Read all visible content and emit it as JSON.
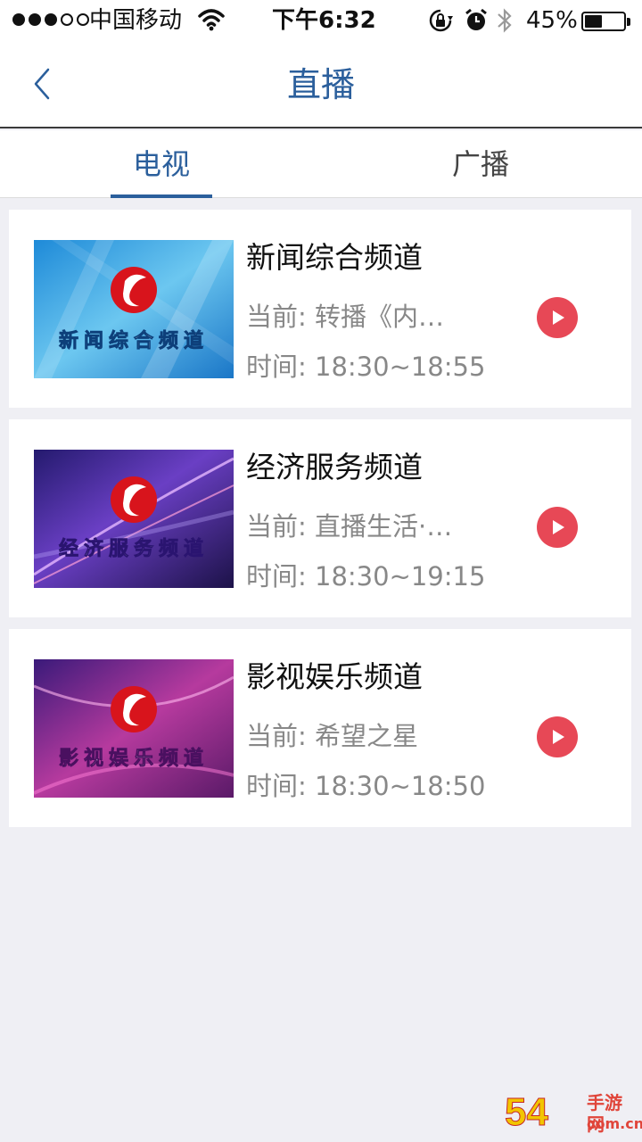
{
  "status_bar": {
    "carrier": "中国移动",
    "time": "下午6:32",
    "battery_text": "45%",
    "battery_level": 0.45
  },
  "nav": {
    "title": "直播"
  },
  "tabs": [
    {
      "label": "电视",
      "active": true
    },
    {
      "label": "广播",
      "active": false
    }
  ],
  "channels": [
    {
      "name": "新闻综合频道",
      "current": "当前: 转播《内…",
      "time": "时间: 18:30~18:55",
      "thumb_text": "新闻综合频道"
    },
    {
      "name": "经济服务频道",
      "current": "当前: 直播生活·…",
      "time": "时间: 18:30~19:15",
      "thumb_text": "经济服务频道"
    },
    {
      "name": "影视娱乐频道",
      "current": "当前: 希望之星",
      "time": "时间: 18:30~18:50",
      "thumb_text": "影视娱乐频道"
    }
  ],
  "watermark": {
    "number": "54",
    "label": "手游网",
    "url": "com.cn"
  },
  "colors": {
    "accent_blue": "#2b5f9c",
    "play_red": "#e74856",
    "background": "#efeff4"
  }
}
